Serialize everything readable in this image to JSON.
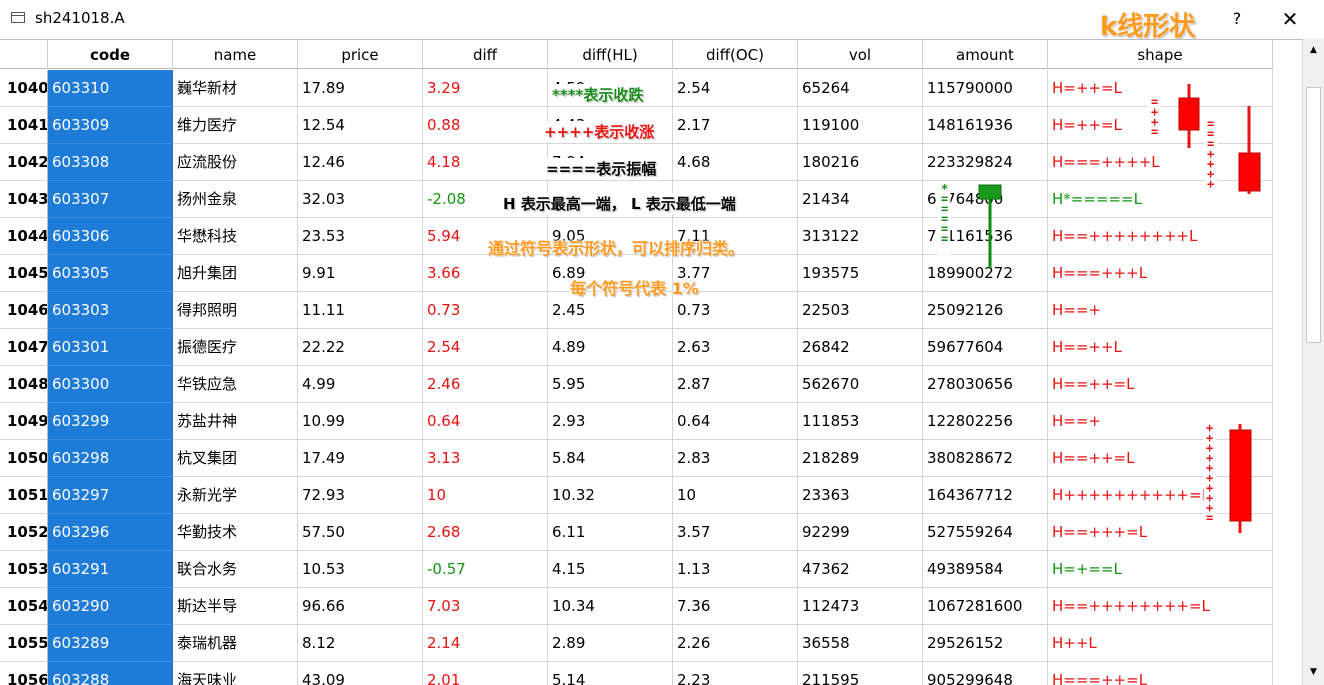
{
  "window": {
    "title": "sh241018.A",
    "title_annotation": "k线形状",
    "help_label": "?",
    "close_label": "✕"
  },
  "table": {
    "columns": [
      "",
      "code",
      "name",
      "price",
      "diff",
      "diff(HL)",
      "diff(OC)",
      "vol",
      "amount",
      "shape"
    ],
    "rows": [
      {
        "num": "1040",
        "code": "603310",
        "name": "巍华新材",
        "price": "17.89",
        "diff": "3.29",
        "diff_color": "red",
        "diffhl": "4.59",
        "diffoc": "2.54",
        "vol": "65264",
        "amount": "115790000",
        "shape": "H=++=L",
        "shape_color": "red"
      },
      {
        "num": "1041",
        "code": "603309",
        "name": "维力医疗",
        "price": "12.54",
        "diff": "0.88",
        "diff_color": "red",
        "diffhl": "4.43",
        "diffoc": "2.17",
        "vol": "119100",
        "amount": "148161936",
        "shape": "H=++=L",
        "shape_color": "red"
      },
      {
        "num": "1042",
        "code": "603308",
        "name": "应流股份",
        "price": "12.46",
        "diff": "4.18",
        "diff_color": "red",
        "diffhl": "7.94",
        "diffoc": "4.68",
        "vol": "180216",
        "amount": "223329824",
        "shape": "H===++++L",
        "shape_color": "red"
      },
      {
        "num": "1043",
        "code": "603307",
        "name": "扬州金泉",
        "price": "32.03",
        "diff": "-2.08",
        "diff_color": "green",
        "diffhl": "",
        "diffoc": "",
        "vol": "21434",
        "amount": "68764800",
        "shape": "H*=====L",
        "shape_color": "green"
      },
      {
        "num": "1044",
        "code": "603306",
        "name": "华懋科技",
        "price": "23.53",
        "diff": "5.94",
        "diff_color": "red",
        "diffhl": "9.05",
        "diffoc": "7.11",
        "vol": "313122",
        "amount": "731161536",
        "shape": "H==++++++++L",
        "shape_color": "red"
      },
      {
        "num": "1045",
        "code": "603305",
        "name": "旭升集团",
        "price": "9.91",
        "diff": "3.66",
        "diff_color": "red",
        "diffhl": "6.89",
        "diffoc": "3.77",
        "vol": "193575",
        "amount": "189900272",
        "shape": "H===+++L",
        "shape_color": "red"
      },
      {
        "num": "1046",
        "code": "603303",
        "name": "得邦照明",
        "price": "11.11",
        "diff": "0.73",
        "diff_color": "red",
        "diffhl": "2.45",
        "diffoc": "0.73",
        "vol": "22503",
        "amount": "25092126",
        "shape": "H==+",
        "shape_color": "red"
      },
      {
        "num": "1047",
        "code": "603301",
        "name": "振德医疗",
        "price": "22.22",
        "diff": "2.54",
        "diff_color": "red",
        "diffhl": "4.89",
        "diffoc": "2.63",
        "vol": "26842",
        "amount": "59677604",
        "shape": "H==++L",
        "shape_color": "red"
      },
      {
        "num": "1048",
        "code": "603300",
        "name": "华铁应急",
        "price": "4.99",
        "diff": "2.46",
        "diff_color": "red",
        "diffhl": "5.95",
        "diffoc": "2.87",
        "vol": "562670",
        "amount": "278030656",
        "shape": "H==++=L",
        "shape_color": "red"
      },
      {
        "num": "1049",
        "code": "603299",
        "name": "苏盐井神",
        "price": "10.99",
        "diff": "0.64",
        "diff_color": "red",
        "diffhl": "2.93",
        "diffoc": "0.64",
        "vol": "111853",
        "amount": "122802256",
        "shape": "H==+",
        "shape_color": "red"
      },
      {
        "num": "1050",
        "code": "603298",
        "name": "杭叉集团",
        "price": "17.49",
        "diff": "3.13",
        "diff_color": "red",
        "diffhl": "5.84",
        "diffoc": "2.83",
        "vol": "218289",
        "amount": "380828672",
        "shape": "H==++=L",
        "shape_color": "red"
      },
      {
        "num": "1051",
        "code": "603297",
        "name": "永新光学",
        "price": "72.93",
        "diff": "10",
        "diff_color": "red",
        "diffhl": "10.32",
        "diffoc": "10",
        "vol": "23363",
        "amount": "164367712",
        "shape": "H++++++++++=L",
        "shape_color": "red"
      },
      {
        "num": "1052",
        "code": "603296",
        "name": "华勤技术",
        "price": "57.50",
        "diff": "2.68",
        "diff_color": "red",
        "diffhl": "6.11",
        "diffoc": "3.57",
        "vol": "92299",
        "amount": "527559264",
        "shape": "H==+++=L",
        "shape_color": "red"
      },
      {
        "num": "1053",
        "code": "603291",
        "name": "联合水务",
        "price": "10.53",
        "diff": "-0.57",
        "diff_color": "green",
        "diffhl": "4.15",
        "diffoc": "1.13",
        "vol": "47362",
        "amount": "49389584",
        "shape": "H=+==L",
        "shape_color": "green"
      },
      {
        "num": "1054",
        "code": "603290",
        "name": "斯达半导",
        "price": "96.66",
        "diff": "7.03",
        "diff_color": "red",
        "diffhl": "10.34",
        "diffoc": "7.36",
        "vol": "112473",
        "amount": "1067281600",
        "shape": "H==++++++++=L",
        "shape_color": "red"
      },
      {
        "num": "1055",
        "code": "603289",
        "name": "泰瑞机器",
        "price": "8.12",
        "diff": "2.14",
        "diff_color": "red",
        "diffhl": "2.89",
        "diffoc": "2.26",
        "vol": "36558",
        "amount": "29526152",
        "shape": "H++L",
        "shape_color": "red"
      },
      {
        "num": "1056",
        "code": "603288",
        "name": "海天味业",
        "price": "43.09",
        "diff": "2.01",
        "diff_color": "red",
        "diffhl": "5.14",
        "diffoc": "2.23",
        "vol": "211595",
        "amount": "905299648",
        "shape": "H===++=L",
        "shape_color": "red"
      }
    ]
  },
  "annotations": {
    "fall": "****表示收跌",
    "rise": "++++表示收涨",
    "amplitude": "====表示振幅",
    "high_low": "H 表示最高一端， L 表示最低一端",
    "sort_hint": "通过符号表示形状，可以排序归类。",
    "percent_hint": "每个符号代表 1%"
  },
  "colors": {
    "selection_blue": "#1e7bd8",
    "rise_red": "#e81212",
    "fall_green": "#129612",
    "annotation_orange": "#ff9a1e"
  }
}
